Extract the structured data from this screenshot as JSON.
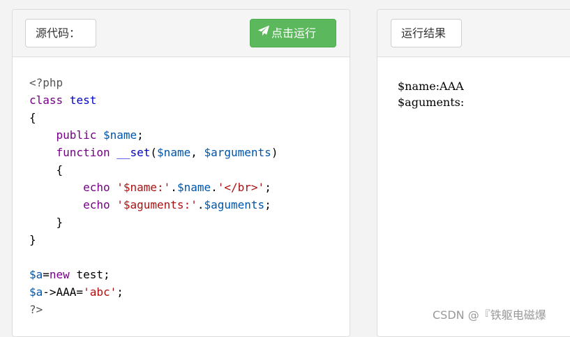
{
  "code_panel": {
    "header_label": "源代码：",
    "run_button_label": "点击运行",
    "run_icon": "paper-plane-icon"
  },
  "result_panel": {
    "header_label": "运行结果"
  },
  "code_lines": [
    [
      {
        "t": "<?php",
        "c": "meta"
      }
    ],
    [
      {
        "t": "class",
        "c": "kw"
      },
      {
        "t": " ",
        "c": "plain"
      },
      {
        "t": "test",
        "c": "def"
      }
    ],
    [
      {
        "t": "{",
        "c": "plain"
      }
    ],
    [
      {
        "t": "    ",
        "c": "plain"
      },
      {
        "t": "public",
        "c": "kw"
      },
      {
        "t": " ",
        "c": "plain"
      },
      {
        "t": "$name",
        "c": "var"
      },
      {
        "t": ";",
        "c": "plain"
      }
    ],
    [
      {
        "t": "    ",
        "c": "plain"
      },
      {
        "t": "function",
        "c": "kw"
      },
      {
        "t": " ",
        "c": "plain"
      },
      {
        "t": "__set",
        "c": "def"
      },
      {
        "t": "(",
        "c": "plain"
      },
      {
        "t": "$name",
        "c": "var"
      },
      {
        "t": ", ",
        "c": "plain"
      },
      {
        "t": "$arguments",
        "c": "var"
      },
      {
        "t": ")",
        "c": "plain"
      }
    ],
    [
      {
        "t": "    {",
        "c": "plain"
      }
    ],
    [
      {
        "t": "        ",
        "c": "plain"
      },
      {
        "t": "echo",
        "c": "kw"
      },
      {
        "t": " ",
        "c": "plain"
      },
      {
        "t": "'$name:'",
        "c": "str"
      },
      {
        "t": ".",
        "c": "plain"
      },
      {
        "t": "$name",
        "c": "var"
      },
      {
        "t": ".",
        "c": "plain"
      },
      {
        "t": "'</br>'",
        "c": "str"
      },
      {
        "t": ";",
        "c": "plain"
      }
    ],
    [
      {
        "t": "        ",
        "c": "plain"
      },
      {
        "t": "echo",
        "c": "kw"
      },
      {
        "t": " ",
        "c": "plain"
      },
      {
        "t": "'$aguments:'",
        "c": "str"
      },
      {
        "t": ".",
        "c": "plain"
      },
      {
        "t": "$aguments",
        "c": "var"
      },
      {
        "t": ";",
        "c": "plain"
      }
    ],
    [
      {
        "t": "    }",
        "c": "plain"
      }
    ],
    [
      {
        "t": "}",
        "c": "plain"
      }
    ],
    [
      {
        "t": "",
        "c": "plain"
      }
    ],
    [
      {
        "t": "$a",
        "c": "var"
      },
      {
        "t": "=",
        "c": "plain"
      },
      {
        "t": "new",
        "c": "kw"
      },
      {
        "t": " test;",
        "c": "plain"
      }
    ],
    [
      {
        "t": "$a",
        "c": "var"
      },
      {
        "t": "->AAA=",
        "c": "plain"
      },
      {
        "t": "'abc'",
        "c": "str"
      },
      {
        "t": ";",
        "c": "plain"
      }
    ],
    [
      {
        "t": "?>",
        "c": "meta"
      }
    ]
  ],
  "output_lines": [
    "$name:AAA",
    "$aguments:"
  ],
  "watermark": "CSDN @『铁躯电磁爆",
  "colors": {
    "keyword": "#770088",
    "definition": "#0000cc",
    "variable": "#0055aa",
    "string": "#aa1111",
    "meta": "#555555",
    "run_button": "#5cb85c"
  }
}
